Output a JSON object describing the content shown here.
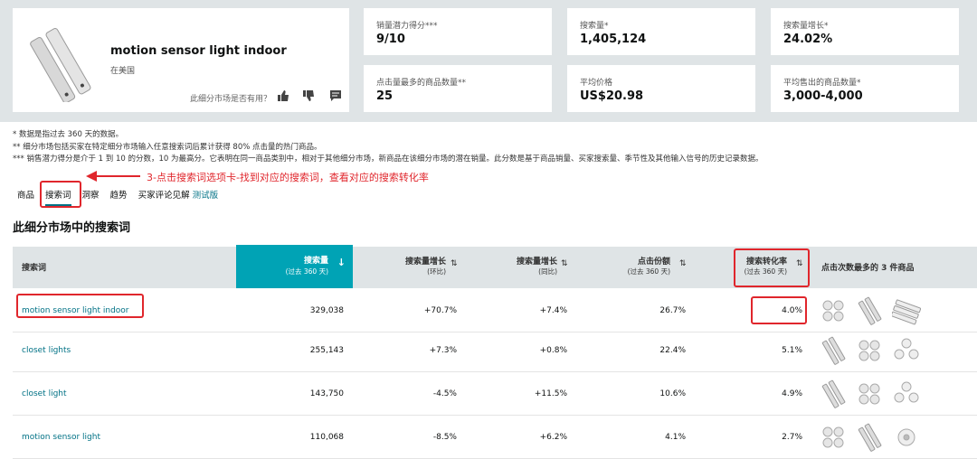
{
  "product": {
    "title": "motion sensor light indoor",
    "region": "在美国",
    "feedback_question": "此细分市场是否有用？"
  },
  "metrics": [
    {
      "label": "销量潜力得分***",
      "value": "9/10"
    },
    {
      "label": "搜索量*",
      "value": "1,405,124"
    },
    {
      "label": "搜索量增长*",
      "value": "24.02%"
    },
    {
      "label": "点击量最多的商品数量**",
      "value": "25"
    },
    {
      "label": "平均价格",
      "value": "US$20.98"
    },
    {
      "label": "平均售出的商品数量*",
      "value": "3,000-4,000"
    }
  ],
  "notes": [
    "* 数据是指过去 360 天的数据。",
    "** 细分市场包括买家在特定细分市场输入任意搜索词后累计获得 80% 点击量的热门商品。",
    "*** 销售潜力得分是介于 1 到 10 的分数，10 为最高分。它表明在同一商品类别中，相对于其他细分市场，新商品在该细分市场的潜在销量。此分数是基于商品销量、买家搜索量、季节性及其他输入信号的历史记录数据。"
  ],
  "annotation": "3-点击搜索词选项卡-找到对应的搜索词，查看对应的搜索转化率",
  "tabs": [
    "商品",
    "搜索词",
    "洞察",
    "趋势",
    "买家评论见解"
  ],
  "tab_beta": "测试版",
  "section_title": "此细分市场中的搜索词",
  "table": {
    "headers": {
      "term": "搜索词",
      "volume": "搜索量",
      "volume_sub": "(过去 360 天)",
      "growth_qoq": "搜索量增长",
      "growth_qoq_sub": "(环比)",
      "growth_yoy": "搜索量增长",
      "growth_yoy_sub": "(同比)",
      "click_share": "点击份额",
      "click_share_sub": "(过去 360 天)",
      "conversion": "搜索转化率",
      "conversion_sub": "(过去 360 天)",
      "top_products": "点击次数最多的 3 件商品"
    },
    "rows": [
      {
        "term": "motion sensor light indoor",
        "volume": "329,038",
        "qoq": "+70.7%",
        "yoy": "+7.4%",
        "share": "26.7%",
        "conv": "4.0%"
      },
      {
        "term": "closet lights",
        "volume": "255,143",
        "qoq": "+7.3%",
        "yoy": "+0.8%",
        "share": "22.4%",
        "conv": "5.1%"
      },
      {
        "term": "closet light",
        "volume": "143,750",
        "qoq": "-4.5%",
        "yoy": "+11.5%",
        "share": "10.6%",
        "conv": "4.9%"
      },
      {
        "term": "motion sensor light",
        "volume": "110,068",
        "qoq": "-8.5%",
        "yoy": "+6.2%",
        "share": "4.1%",
        "conv": "2.7%"
      }
    ]
  },
  "colors": {
    "accent": "#00a3b5",
    "link": "#007185",
    "annotation": "#e0262c"
  }
}
